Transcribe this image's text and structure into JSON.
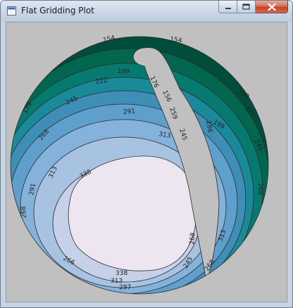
{
  "window": {
    "title": "Flat Gridding Plot",
    "controls": {
      "minimize": "minimize",
      "maximize": "maximize",
      "close": "close"
    }
  },
  "colors": {
    "client_bg": "#c0c0c0",
    "palette": [
      "#004d3c",
      "#03664f",
      "#077a6f",
      "#1a8a9a",
      "#3f8eb8",
      "#5f9fcc",
      "#84b2da",
      "#a8c3e2",
      "#c6d0e8",
      "#dcdfee",
      "#ede6f1"
    ]
  },
  "chart_data": {
    "type": "contour",
    "description_free": true,
    "contour_levels": [
      154,
      179,
      199,
      222,
      245,
      268,
      291,
      313,
      338
    ],
    "labels": {
      "l154a": "154",
      "l154b": "154",
      "l179": "179",
      "l199": "199",
      "l222": "222",
      "l245": "245",
      "l291a": "291",
      "l313a": "313",
      "l338a": "338",
      "l268a": "268",
      "l291b": "291",
      "l313b": "313",
      "l268b": "268",
      "l266": "266",
      "l338b": "338",
      "l313c": "313",
      "l297": "297",
      "l176": "176",
      "l156": "156",
      "l259": "259",
      "l245b": "245",
      "l286": "286",
      "l199b": "199",
      "l222b": "222",
      "l245c": "245",
      "l268c": "268",
      "l199c": "199",
      "l268d": "268",
      "l313d": "313",
      "l245d": "245",
      "l268e": "268"
    }
  }
}
